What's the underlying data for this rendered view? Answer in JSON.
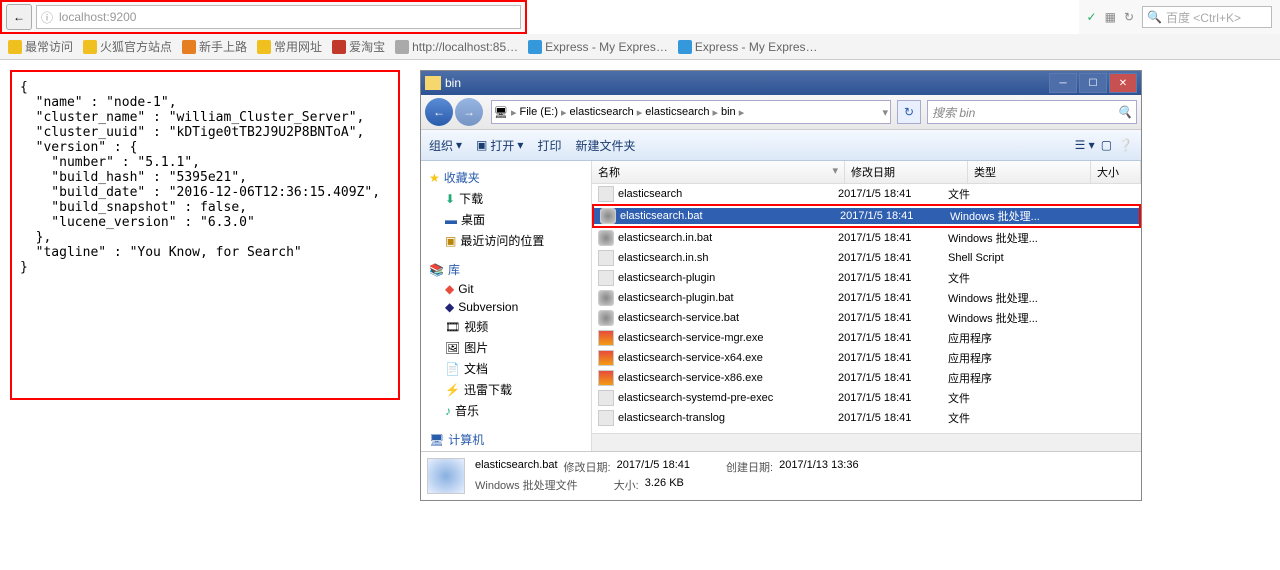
{
  "browser": {
    "url_prefix": "localhost",
    "url_port": ":9200",
    "search_placeholder": "百度 <Ctrl+K>",
    "shield_icon": "✓",
    "grid_icon": "▦",
    "reload_icon": "↻",
    "search_icon": "🔍"
  },
  "bookmarks": [
    {
      "label": "最常访问"
    },
    {
      "label": "火狐官方站点"
    },
    {
      "label": "新手上路"
    },
    {
      "label": "常用网址"
    },
    {
      "label": "爱淘宝"
    },
    {
      "label": "http://localhost:85…"
    },
    {
      "label": "Express - My Expres…"
    },
    {
      "label": "Express - My Expres…"
    }
  ],
  "json_text": "{\n  \"name\" : \"node-1\",\n  \"cluster_name\" : \"william_Cluster_Server\",\n  \"cluster_uuid\" : \"kDTige0tTB2J9U2P8BNToA\",\n  \"version\" : {\n    \"number\" : \"5.1.1\",\n    \"build_hash\" : \"5395e21\",\n    \"build_date\" : \"2016-12-06T12:36:15.409Z\",\n    \"build_snapshot\" : false,\n    \"lucene_version\" : \"6.3.0\"\n  },\n  \"tagline\" : \"You Know, for Search\"\n}",
  "explorer": {
    "title": "bin",
    "breadcrumb": [
      "File (E:)",
      "elasticsearch",
      "elasticsearch",
      "bin"
    ],
    "breadcrumb_prefix": "▶",
    "search_placeholder": "搜索 bin",
    "toolbar": {
      "organize": "组织",
      "open": "打开",
      "print": "打印",
      "newfolder": "新建文件夹"
    },
    "side": {
      "favorites": "收藏夹",
      "downloads": "下载",
      "desktop": "桌面",
      "recent": "最近访问的位置",
      "libraries": "库",
      "git": "Git",
      "svn": "Subversion",
      "video": "视频",
      "pictures": "图片",
      "documents": "文档",
      "thunder": "迅雷下载",
      "music": "音乐",
      "computer": "计算机"
    },
    "headers": {
      "name": "名称",
      "date": "修改日期",
      "type": "类型",
      "size": "大小"
    },
    "files": [
      {
        "name": "elasticsearch",
        "date": "2017/1/5 18:41",
        "type": "文件",
        "icon": "sh"
      },
      {
        "name": "elasticsearch.bat",
        "date": "2017/1/5 18:41",
        "type": "Windows 批处理...",
        "icon": "gear",
        "selected": true
      },
      {
        "name": "elasticsearch.in.bat",
        "date": "2017/1/5 18:41",
        "type": "Windows 批处理...",
        "icon": "gear"
      },
      {
        "name": "elasticsearch.in.sh",
        "date": "2017/1/5 18:41",
        "type": "Shell Script",
        "icon": "sh"
      },
      {
        "name": "elasticsearch-plugin",
        "date": "2017/1/5 18:41",
        "type": "文件",
        "icon": "sh"
      },
      {
        "name": "elasticsearch-plugin.bat",
        "date": "2017/1/5 18:41",
        "type": "Windows 批处理...",
        "icon": "gear"
      },
      {
        "name": "elasticsearch-service.bat",
        "date": "2017/1/5 18:41",
        "type": "Windows 批处理...",
        "icon": "gear"
      },
      {
        "name": "elasticsearch-service-mgr.exe",
        "date": "2017/1/5 18:41",
        "type": "应用程序",
        "icon": "exe"
      },
      {
        "name": "elasticsearch-service-x64.exe",
        "date": "2017/1/5 18:41",
        "type": "应用程序",
        "icon": "exe"
      },
      {
        "name": "elasticsearch-service-x86.exe",
        "date": "2017/1/5 18:41",
        "type": "应用程序",
        "icon": "exe"
      },
      {
        "name": "elasticsearch-systemd-pre-exec",
        "date": "2017/1/5 18:41",
        "type": "文件",
        "icon": "sh"
      },
      {
        "name": "elasticsearch-translog",
        "date": "2017/1/5 18:41",
        "type": "文件",
        "icon": "sh"
      }
    ],
    "status": {
      "filename": "elasticsearch.bat",
      "modlabel": "修改日期:",
      "moddate": "2017/1/5 18:41",
      "createlabel": "创建日期:",
      "createdate": "2017/1/13 13:36",
      "typetext": "Windows 批处理文件",
      "sizelabel": "大小:",
      "sizeval": "3.26 KB"
    }
  }
}
